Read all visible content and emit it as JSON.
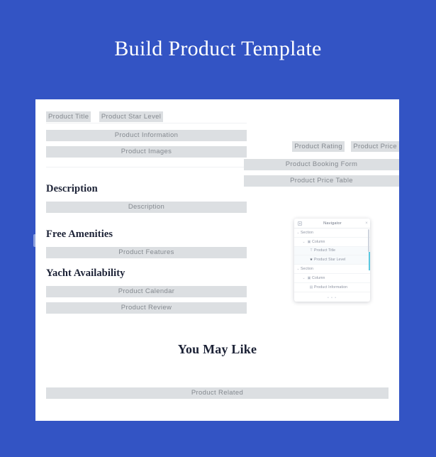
{
  "page": {
    "title": "Build Product Template",
    "background_color": "#3354c4",
    "canvas_color": "#ffffff",
    "widget_color": "#dcdfe2",
    "widget_text_color": "#84898f",
    "heading_color": "#1b2135",
    "accent_color": "#5bc8e0"
  },
  "left_column": {
    "tags": [
      {
        "label": "Product Title"
      },
      {
        "label": "Product Star Level"
      }
    ],
    "widgets": [
      {
        "label": "Product Information"
      },
      {
        "label": "Product Images"
      }
    ],
    "sections": [
      {
        "heading": "Description",
        "widgets": [
          {
            "label": "Description"
          }
        ]
      },
      {
        "heading": "Free Amenities",
        "widgets": [
          {
            "label": "Product Features"
          }
        ]
      },
      {
        "heading": "Yacht Availability",
        "widgets": [
          {
            "label": "Product Calendar"
          },
          {
            "label": "Product Review"
          }
        ]
      }
    ]
  },
  "right_column": {
    "tags": [
      {
        "label": "Product Rating"
      },
      {
        "label": "Product Price"
      }
    ],
    "widgets": [
      {
        "label": "Product Booking Form"
      },
      {
        "label": "Product Price Table"
      }
    ]
  },
  "bottom_band": {
    "heading": "You May Like",
    "widgets": [
      {
        "label": "Product Related"
      }
    ]
  },
  "navigator": {
    "title": "Navigator",
    "panel_icon": "panel-icon",
    "close_icon": "×",
    "grip": "• • •",
    "rows": [
      {
        "label": "Section",
        "depth": 1,
        "caret": "⌄",
        "icon": "",
        "selected": false
      },
      {
        "label": "Column",
        "depth": 2,
        "caret": "⌄",
        "icon": "▣",
        "selected": false
      },
      {
        "label": "Product Title",
        "depth": 3,
        "caret": "",
        "icon": "T",
        "selected": true
      },
      {
        "label": "Product Star Level",
        "depth": 3,
        "caret": "",
        "icon": "★",
        "selected": true
      },
      {
        "label": "Section",
        "depth": 1,
        "caret": "⌄",
        "icon": "",
        "selected": false
      },
      {
        "label": "Column",
        "depth": 2,
        "caret": "⌄",
        "icon": "▣",
        "selected": false
      },
      {
        "label": "Product Information",
        "depth": 3,
        "caret": "",
        "icon": "▤",
        "selected": false
      }
    ]
  }
}
